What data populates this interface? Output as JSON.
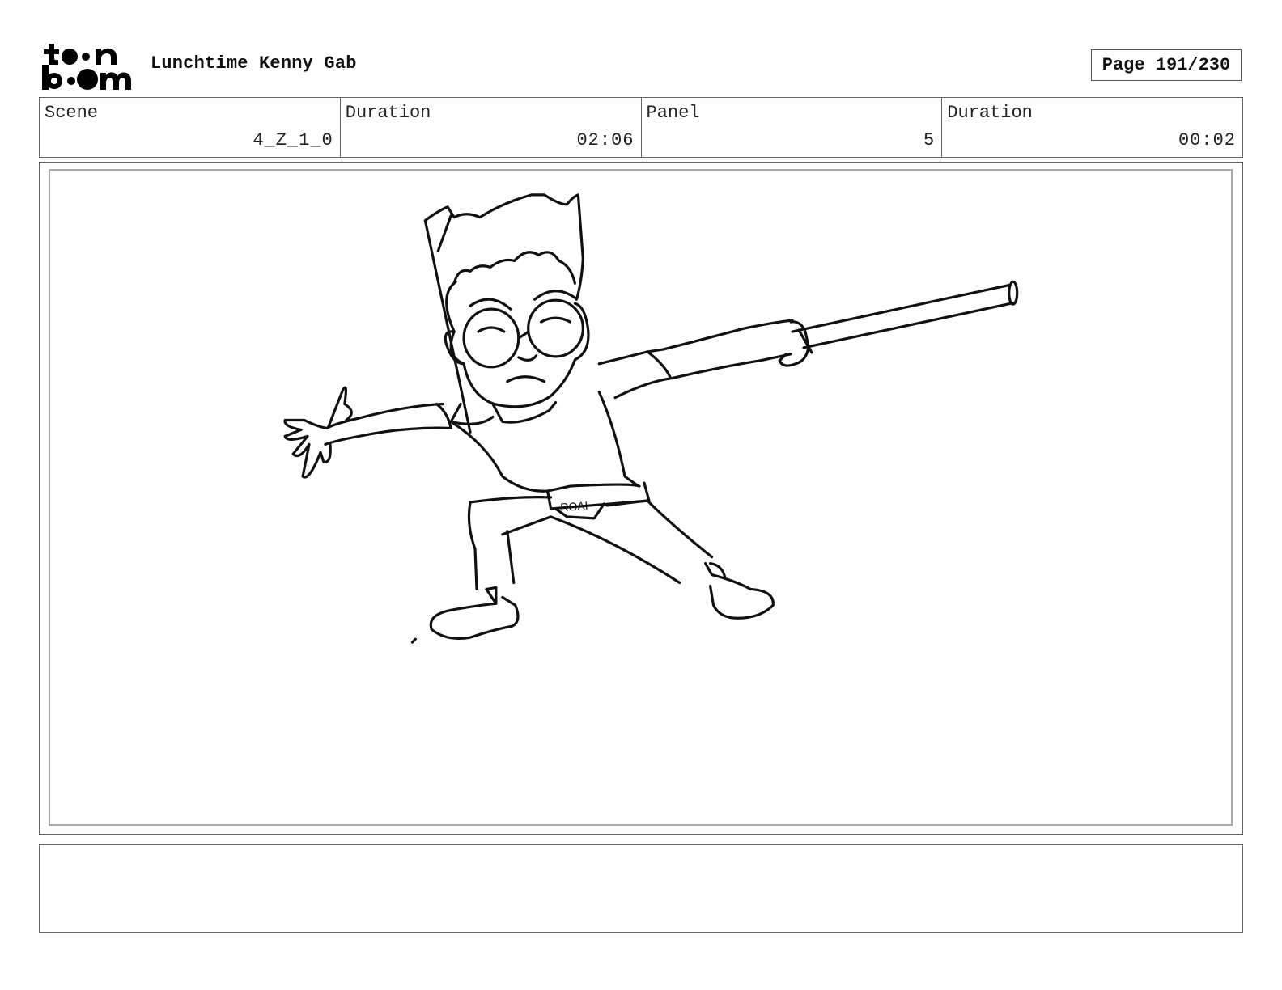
{
  "header": {
    "logo_text": "toon boom",
    "project_title": "Lunchtime Kenny Gab",
    "page_label": "Page 191/230"
  },
  "info": {
    "scene_label": "Scene",
    "scene_value": "4_Z_1_0",
    "scene_duration_label": "Duration",
    "scene_duration_value": "02:06",
    "panel_label": "Panel",
    "panel_value": "5",
    "panel_duration_label": "Duration",
    "panel_duration_value": "00:02"
  },
  "panel": {
    "belt_text": "ROAI"
  },
  "notes": {
    "text": ""
  }
}
